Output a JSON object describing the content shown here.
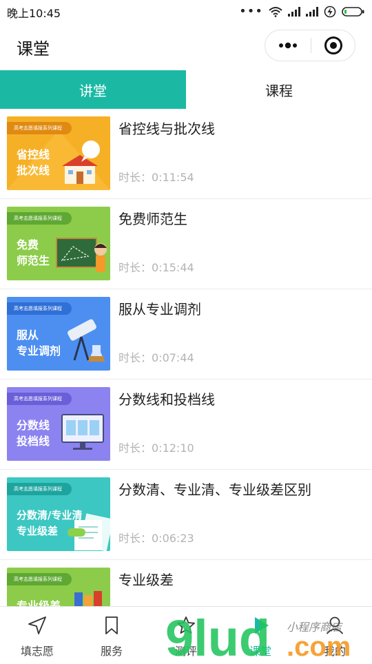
{
  "status_bar": {
    "time": "晚上10:45",
    "signal_dots": "•••"
  },
  "nav": {
    "title": "课堂",
    "capsule_more": "•••"
  },
  "tabs": [
    {
      "label": "讲堂",
      "active": true
    },
    {
      "label": "课程",
      "active": false
    }
  ],
  "courses": [
    {
      "title": "省控线与批次线",
      "duration": "时长：0:11:54",
      "thumb_series": "高考志愿填报系列课程",
      "thumb_text": "省控线\n批次线",
      "thumb_color": "#f6b026",
      "tag_color": "#e08a12"
    },
    {
      "title": "免费师范生",
      "duration": "时长：0:15:44",
      "thumb_series": "高考志愿填报系列课程",
      "thumb_text": "免费\n师范生",
      "thumb_color": "#8dcc4a",
      "tag_color": "#5ea833"
    },
    {
      "title": "服从专业调剂",
      "duration": "时长：0:07:44",
      "thumb_series": "高考志愿填报系列课程",
      "thumb_text": "服从\n专业调剂",
      "thumb_color": "#4d8ff0",
      "tag_color": "#2f6fd6"
    },
    {
      "title": "分数线和投档线",
      "duration": "时长：0:12:10",
      "thumb_series": "高考志愿填报系列课程",
      "thumb_text": "分数线\n投档线",
      "thumb_color": "#8c83f0",
      "tag_color": "#6a5fd8"
    },
    {
      "title": "分数清、专业清、专业级差区别",
      "duration": "时长：0:06:23",
      "thumb_series": "高考志愿填报系列课程",
      "thumb_text": "分数清/专业清\n专业级差",
      "thumb_color": "#3cc7c2",
      "tag_color": "#1ea49f"
    },
    {
      "title": "专业级差",
      "duration": "",
      "thumb_series": "高考志愿填报系列课程",
      "thumb_text": "专业级差",
      "thumb_color": "#8dcc4a",
      "tag_color": "#5ea833"
    }
  ],
  "tabbar": [
    {
      "label": "填志愿",
      "icon": "navigation-arrow-icon",
      "active": false
    },
    {
      "label": "服务",
      "icon": "bookmark-icon",
      "active": false
    },
    {
      "label": "测评",
      "icon": "star-icon",
      "active": false
    },
    {
      "label": "课堂",
      "icon": "play-icon",
      "active": true
    },
    {
      "label": "我的",
      "icon": "user-icon",
      "active": false
    }
  ],
  "watermark": {
    "text_main": "9lud",
    "text_sub": ".com",
    "text_script": "小程序商店"
  },
  "colors": {
    "accent": "#1bb9a4",
    "muted_text": "#b3b3b3",
    "watermark_green": "#22c45e",
    "watermark_orange": "#f59a23"
  }
}
